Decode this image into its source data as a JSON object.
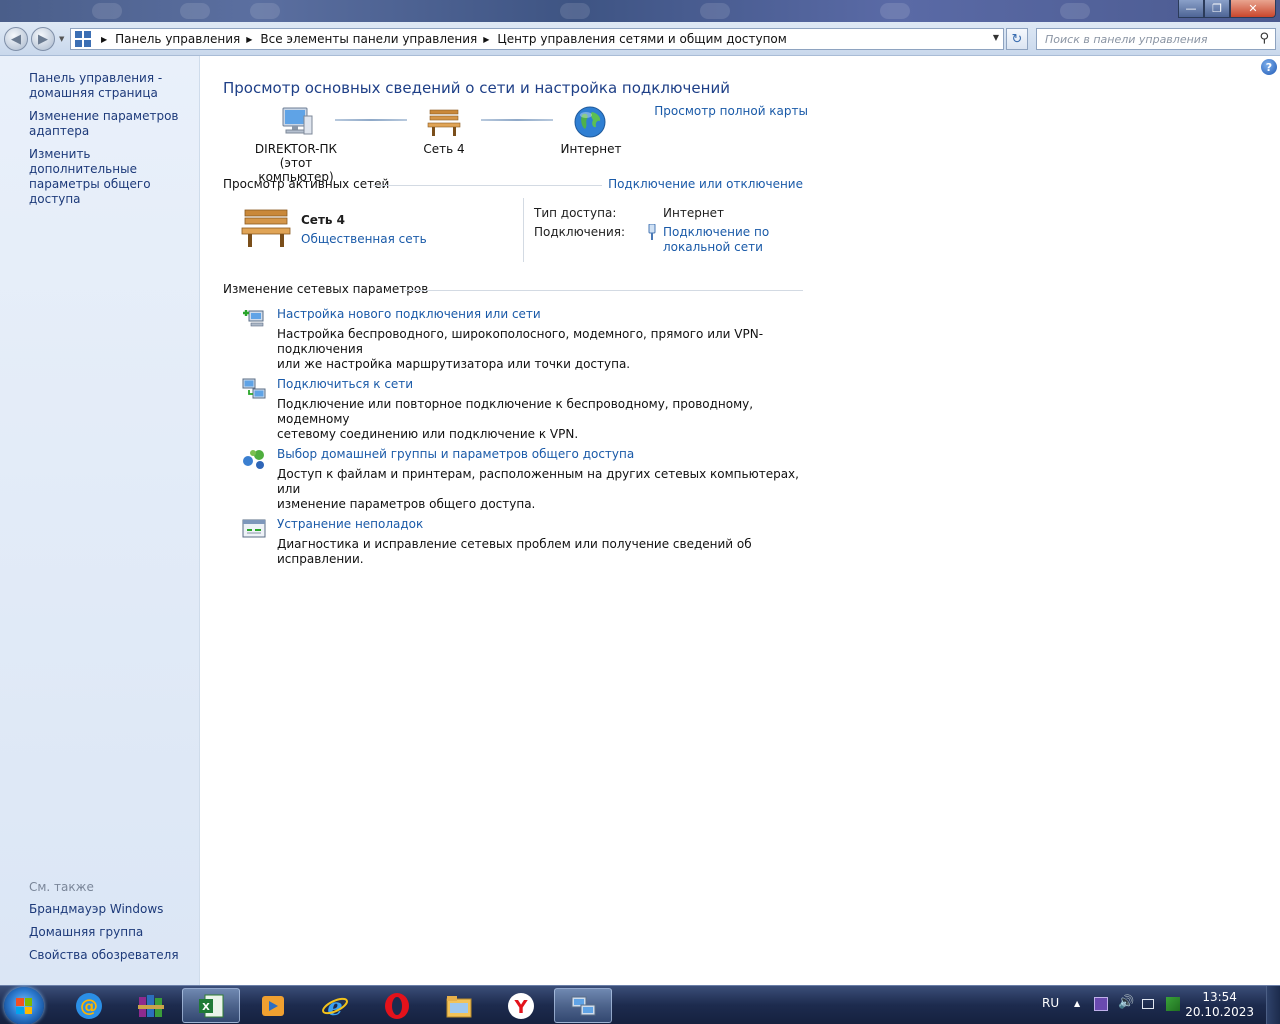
{
  "window": {
    "title": "Центр управления сетями и общим доступом"
  },
  "address": {
    "crumbs": [
      "Панель управления",
      "Все элементы панели управления",
      "Центр управления сетями и общим доступом"
    ],
    "search_placeholder": "Поиск в панели управления"
  },
  "sidebar": {
    "links": [
      "Панель управления - домашняя страница",
      "Изменение параметров адаптера",
      "Изменить дополнительные параметры общего доступа"
    ],
    "see_also_header": "См. также",
    "see_also": [
      "Брандмауэр Windows",
      "Домашняя группа",
      "Свойства обозревателя"
    ]
  },
  "main": {
    "title": "Просмотр основных сведений о сети и настройка подключений",
    "full_map_link": "Просмотр полной карты",
    "map": {
      "computer_name": "DIREKTOR-ПК",
      "computer_sub": "(этот компьютер)",
      "network_name": "Сеть 4",
      "internet": "Интернет"
    },
    "active_header": "Просмотр активных сетей",
    "connect_link": "Подключение или отключение",
    "active": {
      "name": "Сеть 4",
      "type": "Общественная сеть",
      "access_label": "Тип доступа:",
      "access_value": "Интернет",
      "conn_label": "Подключения:",
      "conn_value_1": "Подключение по",
      "conn_value_2": "локальной сети"
    },
    "change_header": "Изменение сетевых параметров",
    "tasks": [
      {
        "link": "Настройка нового подключения или сети",
        "desc1": "Настройка беспроводного, широкополосного, модемного, прямого или VPN-подключения",
        "desc2": "или же настройка маршрутизатора или точки доступа."
      },
      {
        "link": "Подключиться к сети",
        "desc1": "Подключение или повторное подключение к беспроводному, проводному, модемному",
        "desc2": "сетевому соединению или подключение к VPN."
      },
      {
        "link": "Выбор домашней группы и параметров общего доступа",
        "desc1": "Доступ к файлам и принтерам, расположенным на других сетевых компьютерах, или",
        "desc2": "изменение параметров общего доступа."
      },
      {
        "link": "Устранение неполадок",
        "desc1": "Диагностика и исправление сетевых проблем или получение сведений об исправлении.",
        "desc2": ""
      }
    ]
  },
  "taskbar": {
    "apps": [
      "mail-ru-agent",
      "winrar",
      "excel",
      "media-player",
      "internet-explorer",
      "opera",
      "file-explorer",
      "yandex-browser",
      "network-center"
    ],
    "lang": "RU",
    "time": "13:54",
    "date": "20.10.2023"
  },
  "colors": {
    "link": "#1a5aa8",
    "title": "#1e3f87",
    "sidebar_link": "#1d3a7a"
  }
}
